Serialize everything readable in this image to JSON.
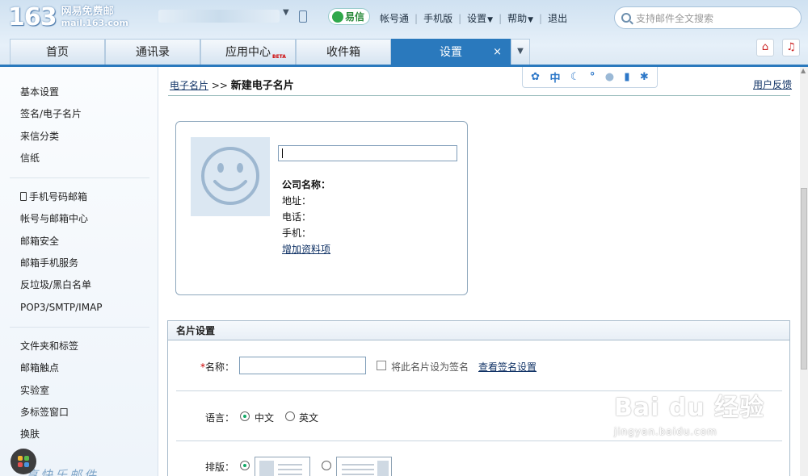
{
  "header": {
    "logo_number": "163",
    "logo_name": "网易免费邮",
    "logo_domain": "mail.163.com",
    "yixin_label": "易信",
    "links": [
      "帐号通",
      "手机版",
      "设置",
      "帮助",
      "退出"
    ],
    "search_placeholder": "支持邮件全文搜索"
  },
  "tabs": [
    {
      "label": "首页"
    },
    {
      "label": "通讯录"
    },
    {
      "label": "应用中心",
      "badge": "BETA"
    },
    {
      "label": "收件箱"
    },
    {
      "label": "设置",
      "active": true,
      "close": "×"
    }
  ],
  "sidebar": {
    "group1": [
      "基本设置",
      "签名/电子名片",
      "来信分类",
      "信纸"
    ],
    "group2": [
      "手机号码邮箱",
      "帐号与邮箱中心",
      "邮箱安全",
      "邮箱手机服务",
      "反垃圾/黑白名单",
      "POP3/SMTP/IMAP"
    ],
    "group3": [
      "文件夹和标签",
      "邮箱触点",
      "实验室",
      "多标签窗口",
      "换肤"
    ],
    "footer_script": "享快乐邮件"
  },
  "main": {
    "breadcrumb_link": "电子名片",
    "breadcrumb_sep": ">>",
    "page_title": "新建电子名片",
    "feedback": "用户反馈",
    "toolbar_lang": "中"
  },
  "card": {
    "name_value": "",
    "company_label": "公司名称：",
    "address_label": "地址：",
    "phone_label": "电话：",
    "mobile_label": "手机：",
    "add_field": "增加资料项"
  },
  "settings": {
    "header": "名片设置",
    "name_required_mark": "*",
    "name_label": "名称：",
    "name_value": "",
    "sig_checkbox_label": "将此名片设为签名",
    "sig_checked": false,
    "view_sig_link": "查看签名设置",
    "lang_label": "语言：",
    "lang_options": [
      "中文",
      "英文"
    ],
    "lang_selected": "中文",
    "layout_label": "排版："
  },
  "watermark": {
    "brand": "Bai du 经验",
    "url": "jingyan.baidu.com"
  },
  "colors": {
    "accent": "#2a79bd",
    "link": "#113366",
    "header_bg": "#cfe1f1"
  }
}
